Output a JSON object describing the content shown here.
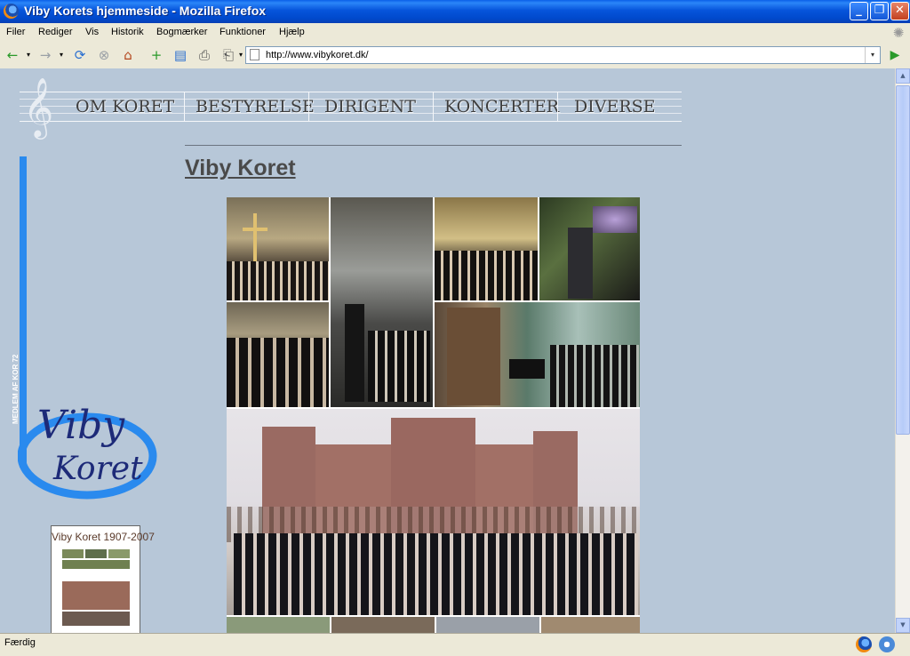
{
  "window": {
    "title": "Viby Korets hjemmeside - Mozilla Firefox",
    "min_glyph": "_",
    "max_glyph": "❐",
    "close_glyph": "✕"
  },
  "menu": {
    "items": [
      {
        "label": "Filer",
        "key": "F"
      },
      {
        "label": "Rediger",
        "key": "R"
      },
      {
        "label": "Vis",
        "key": "V"
      },
      {
        "label": "Historik",
        "key": "H"
      },
      {
        "label": "Bogmærker",
        "key": "B"
      },
      {
        "label": "Funktioner",
        "key": "u"
      },
      {
        "label": "Hjælp",
        "key": "j"
      }
    ]
  },
  "toolbar": {
    "back_icon": "←",
    "forward_icon": "→",
    "dropdown_icon": "▾",
    "reload_icon": "⟳",
    "stop_icon": "⊗",
    "home_icon": "⌂",
    "newtab_icon": "+",
    "bookmark_icon": "▤",
    "history_icon": "⎙",
    "print_icon": "⎗",
    "url": "http://www.vibykoret.dk/",
    "go_icon": "▶"
  },
  "page": {
    "nav": [
      "OM KORET",
      "BESTYRELSE",
      "DIRIGENT",
      "KONCERTER",
      "DIVERSE"
    ],
    "clef": "𝄞",
    "title": "Viby Koret",
    "badge": "MEDLEM AF KOR 72",
    "logo_line1": "Viby",
    "logo_line2": "Koret",
    "book_title": "Viby Koret 1907-2007"
  },
  "status": {
    "text": "Færdig"
  },
  "colors": {
    "page_bg": "#b7c7d8",
    "accent_blue": "#2a8aee",
    "logo_navy": "#1d2a78",
    "chrome": "#ece9d8"
  }
}
